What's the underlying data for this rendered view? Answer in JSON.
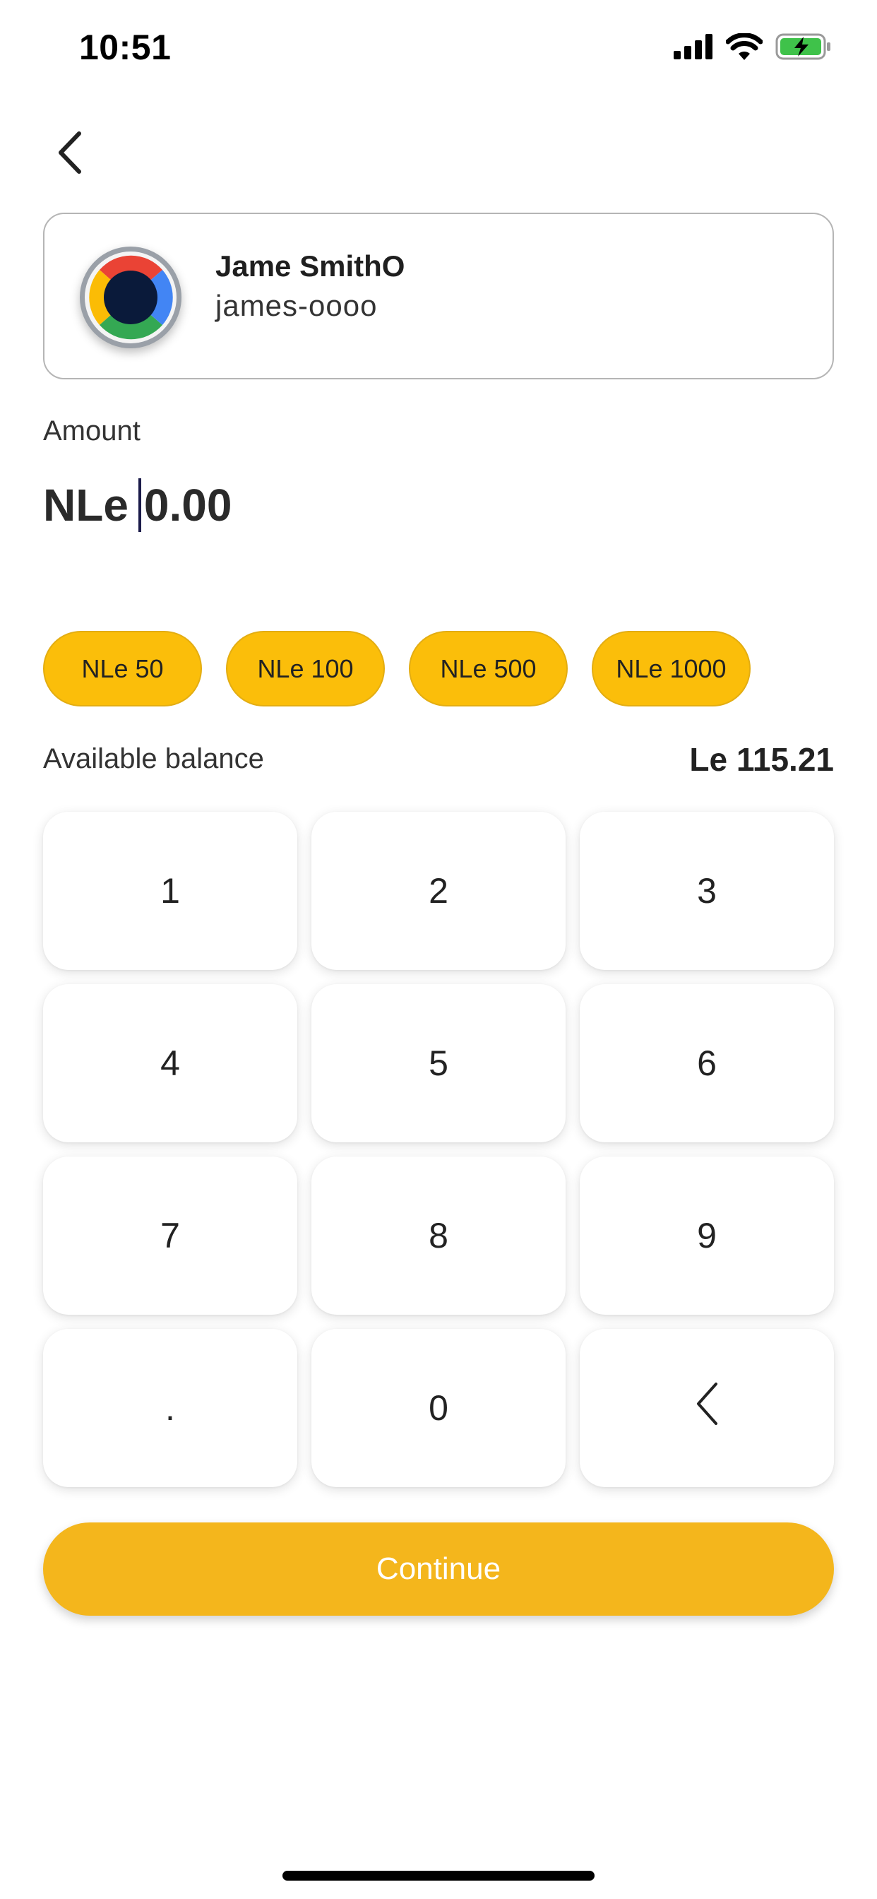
{
  "status_bar": {
    "time": "10:51",
    "icons": [
      "cellular-signal-icon",
      "wifi-icon",
      "battery-charging-icon"
    ]
  },
  "nav": {
    "back_icon": "chevron-left-icon"
  },
  "recipient": {
    "name": "Jame SmithO",
    "handle": "james-oooo",
    "avatar_icon": "google-logo-icon"
  },
  "amount": {
    "label": "Amount",
    "currency": "NLe",
    "value": "0.00"
  },
  "quick_amounts": [
    "NLe 50",
    "NLe 100",
    "NLe 500",
    "NLe 1000"
  ],
  "balance": {
    "label": "Available balance",
    "value": "Le 115.21"
  },
  "keypad": {
    "keys": [
      "1",
      "2",
      "3",
      "4",
      "5",
      "6",
      "7",
      "8",
      "9",
      ".",
      "0",
      "backspace-icon"
    ]
  },
  "continue_label": "Continue",
  "colors": {
    "accent": "#f4b61c",
    "chip": "#fbbe0a",
    "battery_green": "#3fc24a"
  }
}
